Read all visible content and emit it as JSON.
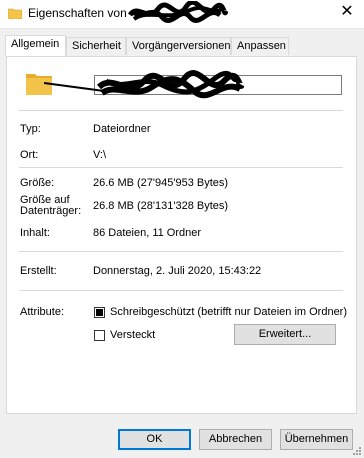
{
  "window": {
    "title": "Eigenschaften von"
  },
  "tabs": [
    {
      "label": "Allgemein"
    },
    {
      "label": "Sicherheit"
    },
    {
      "label": "Vorgängerversionen"
    },
    {
      "label": "Anpassen"
    }
  ],
  "general": {
    "name_value": "",
    "rows": [
      {
        "label": "Typ:",
        "value": "Dateiordner"
      },
      {
        "label": "Ort:",
        "value": "V:\\"
      },
      {
        "label": "Größe:",
        "value": "26.6 MB (27'945'953 Bytes)"
      },
      {
        "label": "Größe auf\nDatenträger:",
        "value": "26.8 MB (28'131'328 Bytes)"
      },
      {
        "label": "Inhalt:",
        "value": "86 Dateien, 11 Ordner"
      },
      {
        "label": "Erstellt:",
        "value": "Donnerstag, 2. Juli 2020, 15:43:22"
      }
    ],
    "attributes_label": "Attribute:",
    "readonly_label": "Schreibgeschützt (betrifft nur Dateien im Ordner)",
    "readonly_checked": true,
    "hidden_label": "Versteckt",
    "hidden_checked": false,
    "advanced_button": "Erweitert..."
  },
  "footer": {
    "ok": "OK",
    "cancel": "Abbrechen",
    "apply": "Übernehmen"
  },
  "icons": {
    "title": "folder-icon",
    "close": "close-icon",
    "folder": "folder-icon",
    "redaction": "redaction-scribble"
  },
  "colors": {
    "accent": "#0078d7",
    "folder": "#f3c34a",
    "panel": "#ffffff",
    "window_bg": "#f0f0f0"
  }
}
